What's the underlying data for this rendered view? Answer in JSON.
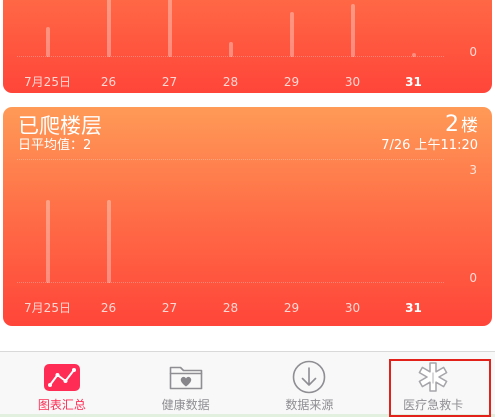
{
  "cards": [
    {
      "y_min": 0,
      "dates": [
        "7月25日",
        "26",
        "27",
        "28",
        "29",
        "30",
        "31"
      ],
      "bar_levels": [
        0.24,
        0.8,
        0.75,
        0.12,
        0.36,
        0.43,
        0.03
      ]
    },
    {
      "title": "已爬楼层",
      "value": "2",
      "unit": "楼",
      "daily_average": "日平均值：2",
      "timestamp": "7/26 上午11:20",
      "y_min": 0,
      "y_max": 3,
      "dates": [
        "7月25日",
        "26",
        "27",
        "28",
        "29",
        "30",
        "31"
      ],
      "values": [
        2,
        2,
        0,
        0,
        0,
        0,
        0
      ]
    }
  ],
  "tabbar": {
    "items": [
      {
        "label": "图表汇总",
        "icon": "chart-icon",
        "active": true
      },
      {
        "label": "健康数据",
        "icon": "folder-heart-icon",
        "active": false
      },
      {
        "label": "数据来源",
        "icon": "download-circle-icon",
        "active": false
      },
      {
        "label": "医疗急救卡",
        "icon": "medical-asterisk-icon",
        "active": false,
        "highlighted": true
      }
    ]
  },
  "colors": {
    "card_top": "#ff9a57",
    "card_mid": "#ff6b46",
    "card_bottom": "#ff4539",
    "active_tab": "#ff2d55",
    "inactive_tab": "#8e8e93",
    "highlight_box": "#e3211b"
  }
}
